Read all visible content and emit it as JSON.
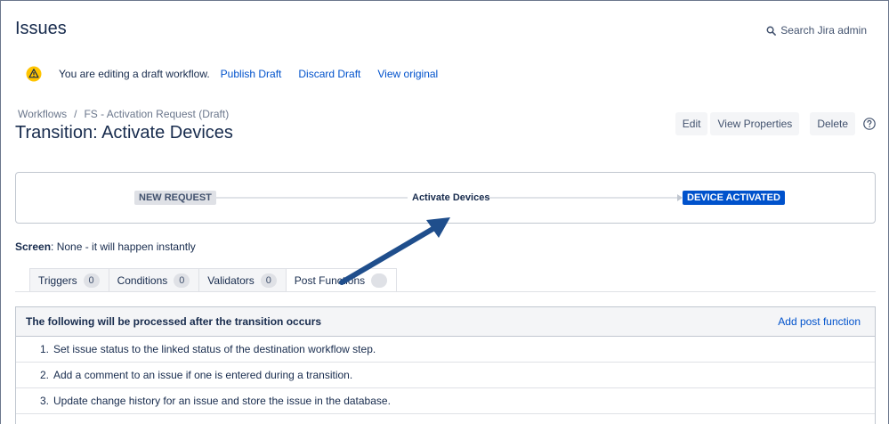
{
  "header": {
    "title": "Issues",
    "search_label": "Search Jira admin"
  },
  "draft": {
    "message": "You are editing a draft workflow.",
    "publish": "Publish Draft",
    "discard": "Discard Draft",
    "view_original": "View original"
  },
  "breadcrumb": {
    "root": "Workflows",
    "separator": "/",
    "current": "FS - Activation Request (Draft)"
  },
  "transition": {
    "title": "Transition: Activate Devices"
  },
  "actions": {
    "edit": "Edit",
    "view_properties": "View Properties",
    "delete": "Delete"
  },
  "diagram": {
    "from_status": "NEW REQUEST",
    "transition_name": "Activate Devices",
    "to_status": "DEVICE ACTIVATED"
  },
  "screen": {
    "label": "Screen",
    "value": ": None - it will happen instantly"
  },
  "tabs": [
    {
      "label": "Triggers",
      "count": "0"
    },
    {
      "label": "Conditions",
      "count": "0"
    },
    {
      "label": "Validators",
      "count": "0"
    },
    {
      "label": "Post Functions",
      "count": ""
    }
  ],
  "post_functions": {
    "header": "The following will be processed after the transition occurs",
    "add_link": "Add post function",
    "items": [
      {
        "num": "1.",
        "text": "Set issue status to the linked status of the destination workflow step."
      },
      {
        "num": "2.",
        "text": "Add a comment to an issue if one is entered during a transition."
      },
      {
        "num": "3.",
        "text": "Update change history for an issue and store the issue in the database."
      }
    ]
  },
  "colors": {
    "link": "#0052cc",
    "to_status_bg": "#0052cc",
    "from_status_bg": "#dfe1e6",
    "annotation_arrow": "#1f4e8c",
    "warning": "#ffc400"
  }
}
